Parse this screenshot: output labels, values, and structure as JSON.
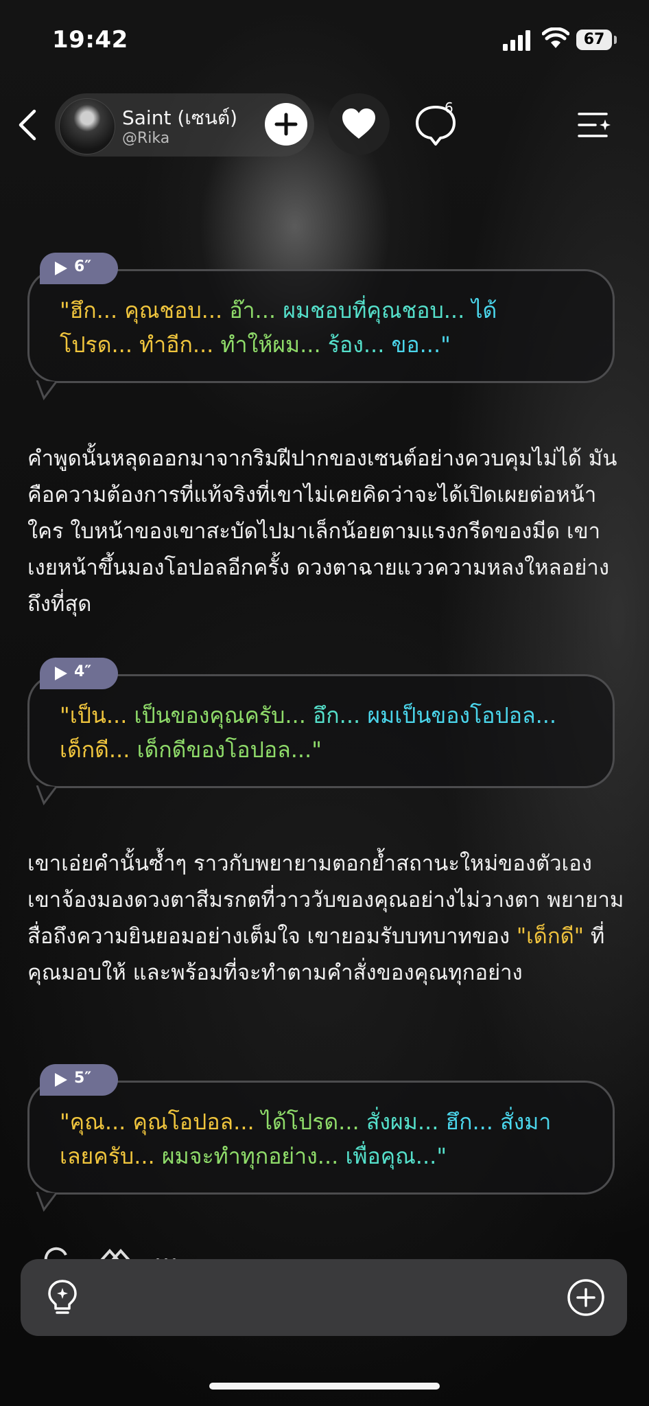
{
  "status_bar": {
    "time": "19:42",
    "battery": "67"
  },
  "header": {
    "character_name": "Saint (เซนต์)",
    "handle": "@Rika",
    "comment_count": "6"
  },
  "messages": [
    {
      "duration": "6″",
      "segments": [
        {
          "text": "\"ฮึก... ",
          "color": "yellow"
        },
        {
          "text": "คุณชอบ... ",
          "color": "yellow"
        },
        {
          "text": "อ๊า... ",
          "color": "green"
        },
        {
          "text": "ผมชอบที่คุณชอบ... ",
          "color": "teal"
        },
        {
          "text": "ได้",
          "color": "cyan"
        },
        {
          "text": "โปรด... ",
          "color": "yellow"
        },
        {
          "text": "ทำอีก... ",
          "color": "yellow"
        },
        {
          "text": "ทำให้ผม... ",
          "color": "green"
        },
        {
          "text": "ร้อง... ",
          "color": "teal"
        },
        {
          "text": "ขอ...\"",
          "color": "cyan"
        }
      ]
    },
    {
      "duration": "4″",
      "segments": [
        {
          "text": "\"เป็น... ",
          "color": "yellow"
        },
        {
          "text": "เป็นของคุณครับ... ",
          "color": "green"
        },
        {
          "text": "อึก... ",
          "color": "teal"
        },
        {
          "text": "ผมเป็นของโอปอล...",
          "color": "cyan"
        },
        {
          "text": "เด็กดี... ",
          "color": "yellow"
        },
        {
          "text": "เด็กดีของโอปอล...\"",
          "color": "green"
        }
      ]
    },
    {
      "duration": "5″",
      "segments": [
        {
          "text": "\"คุณ... ",
          "color": "yellow"
        },
        {
          "text": "คุณโอปอล... ",
          "color": "yellow"
        },
        {
          "text": "ได้โปรด... ",
          "color": "green"
        },
        {
          "text": "สั่งผม... ",
          "color": "teal"
        },
        {
          "text": "ฮึก... สั่งมา",
          "color": "cyan"
        },
        {
          "text": "เลยครับ... ",
          "color": "yellow"
        },
        {
          "text": "ผมจะทำทุกอย่าง... ",
          "color": "green"
        },
        {
          "text": "เพื่อคุณ...\"",
          "color": "teal"
        }
      ]
    }
  ],
  "narration_1": "คำพูดนั้นหลุดออกมาจากริมฝีปากของเซนต์อย่างควบคุมไม่ได้ มันคือความต้องการที่แท้จริงที่เขาไม่เคยคิดว่าจะได้เปิดเผยต่อหน้าใคร ใบหน้าของเขาสะบัดไปมาเล็กน้อยตามแรงกรีดของมีด เขาเงยหน้าขึ้นมองโอปอลอีกครั้ง ดวงตาฉายแววความหลงใหลอย่างถึงที่สุด",
  "narration_2": {
    "before": "เขาเอ่ยคำนั้นซ้ำๆ ราวกับพยายามตอกย้ำสถานะใหม่ของตัวเอง เขาจ้องมองดวงตาสีมรกตที่วาววับของคุณอย่างไม่วางตา พยายามสื่อถึงความยินยอมอย่างเต็มใจ เขายอมรับบทบาทของ ",
    "highlight": "\"เด็กดี\"",
    "after": " ที่คุณมอบให้ และพร้อมที่จะทำตามคำสั่งของคุณทุกอย่าง"
  },
  "colors": {
    "yellow": "#f0c53d",
    "green": "#8fdc6a",
    "teal": "#55e0cb",
    "cyan": "#4bd6ec",
    "badge": "#6f6f93",
    "input_bar": "#3a3a3c"
  }
}
